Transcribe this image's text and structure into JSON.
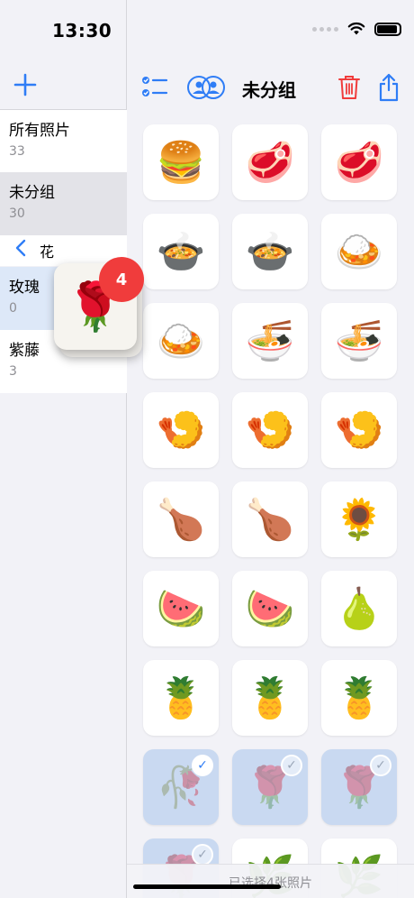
{
  "status": {
    "time": "13:30"
  },
  "sidebar": {
    "albums": [
      {
        "name": "所有照片",
        "count": "33"
      },
      {
        "name": "未分组",
        "count": "30"
      }
    ],
    "folder": {
      "label": "花"
    },
    "sub_albums": [
      {
        "name": "玫瑰",
        "count": "0"
      },
      {
        "name": "紫藤",
        "count": "3"
      }
    ]
  },
  "toolbar": {
    "title": "未分组"
  },
  "drag": {
    "badge": "4"
  },
  "photos": [
    {
      "icon": "hamburger",
      "glyph": "🍔"
    },
    {
      "icon": "steak-plate",
      "glyph": "🥩"
    },
    {
      "icon": "steak-plate",
      "glyph": "🥩"
    },
    {
      "icon": "beef-bowl",
      "glyph": "🍲"
    },
    {
      "icon": "beef-bowl",
      "glyph": "🍲"
    },
    {
      "icon": "katsu-plate",
      "glyph": "🍛"
    },
    {
      "icon": "katsu-plate",
      "glyph": "🍛"
    },
    {
      "icon": "katsudon-bowl",
      "glyph": "🍜"
    },
    {
      "icon": "katsudon-bowl",
      "glyph": "🍜"
    },
    {
      "icon": "fried-fish",
      "glyph": "🍤"
    },
    {
      "icon": "fried-fish",
      "glyph": "🍤"
    },
    {
      "icon": "tempura",
      "glyph": "🍤"
    },
    {
      "icon": "karaage",
      "glyph": "🍗"
    },
    {
      "icon": "karaage",
      "glyph": "🍗"
    },
    {
      "icon": "sunflower",
      "glyph": "🌻"
    },
    {
      "icon": "watermelon-slices",
      "glyph": "🍉"
    },
    {
      "icon": "watermelon-halves",
      "glyph": "🍉"
    },
    {
      "icon": "pears",
      "glyph": "🍐"
    },
    {
      "icon": "pineapple-halves",
      "glyph": "🍍"
    },
    {
      "icon": "pineapple-halves",
      "glyph": "🍍"
    },
    {
      "icon": "pineapple",
      "glyph": "🍍"
    },
    {
      "icon": "grey-rose",
      "glyph": "🥀",
      "selected": true,
      "active": true
    },
    {
      "icon": "rose",
      "glyph": "🌹",
      "selected": true
    },
    {
      "icon": "rose",
      "glyph": "🌹",
      "selected": true
    },
    {
      "icon": "rose",
      "glyph": "🌹",
      "selected": true
    },
    {
      "icon": "wisteria",
      "glyph": "🌿"
    },
    {
      "icon": "wisteria",
      "glyph": "🌿"
    }
  ],
  "bottom": {
    "text": "已选择4张照片"
  },
  "colors": {
    "accent": "#2f7df6",
    "delete": "#f03c3c",
    "badge": "#f03c3c"
  }
}
